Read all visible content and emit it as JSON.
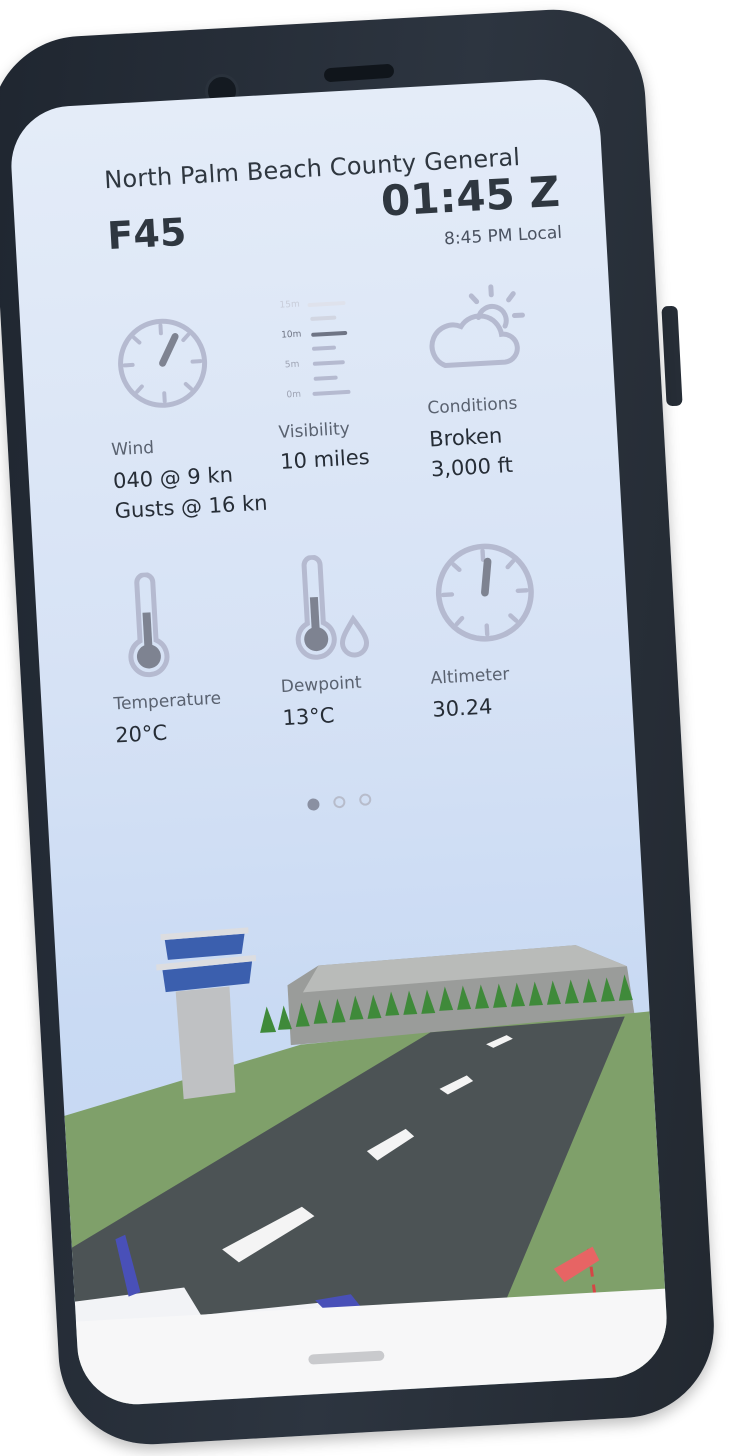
{
  "airport": {
    "name": "North Palm Beach County General",
    "id": "F45"
  },
  "time": {
    "zulu": "01:45 Z",
    "local": "8:45 PM Local"
  },
  "tiles": {
    "wind": {
      "label": "Wind",
      "line1": "040 @ 9 kn",
      "line2": "Gusts @ 16 kn"
    },
    "visibility": {
      "label": "Visibility",
      "value": "10 miles",
      "scale": [
        "15m",
        "10m",
        "5m",
        "0m"
      ]
    },
    "conditions": {
      "label": "Conditions",
      "line1": "Broken",
      "line2": "3,000 ft"
    },
    "temperature": {
      "label": "Temperature",
      "value": "20°C"
    },
    "dewpoint": {
      "label": "Dewpoint",
      "value": "13°C"
    },
    "altimeter": {
      "label": "Altimeter",
      "value": "30.24"
    }
  },
  "pager": {
    "pages": 3,
    "active_index": 0
  },
  "colors": {
    "icon": "#b5bad0",
    "icon_dark": "#7e8391",
    "text": "#262d36",
    "grass": "#7fa06a",
    "runway": "#4c5355",
    "sky": "#d6e2f5"
  },
  "icons": [
    "wind-gauge-icon",
    "visibility-scale-icon",
    "partly-cloudy-icon",
    "thermometer-icon",
    "dewpoint-icon",
    "altimeter-gauge-icon"
  ]
}
